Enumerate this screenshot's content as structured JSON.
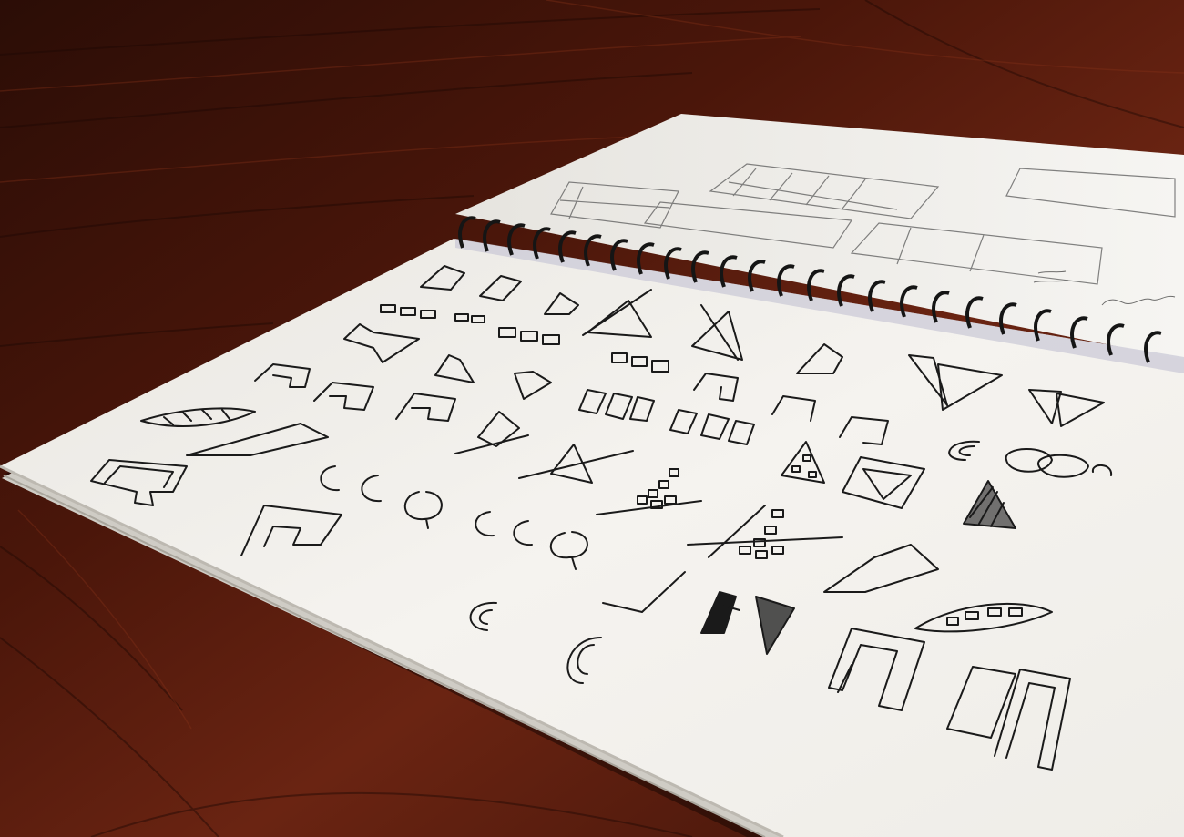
{
  "scene": {
    "subject": "spiral-notebook-logo-sketches",
    "colors": {
      "table_dark": "#2b0d06",
      "table_mid": "#5a1c0e",
      "table_light": "#7a2a14",
      "page": "#f3f1ec",
      "page_shadow": "#d9d6cf",
      "ink": "#1a1a1a",
      "spiral": "#151515"
    }
  }
}
